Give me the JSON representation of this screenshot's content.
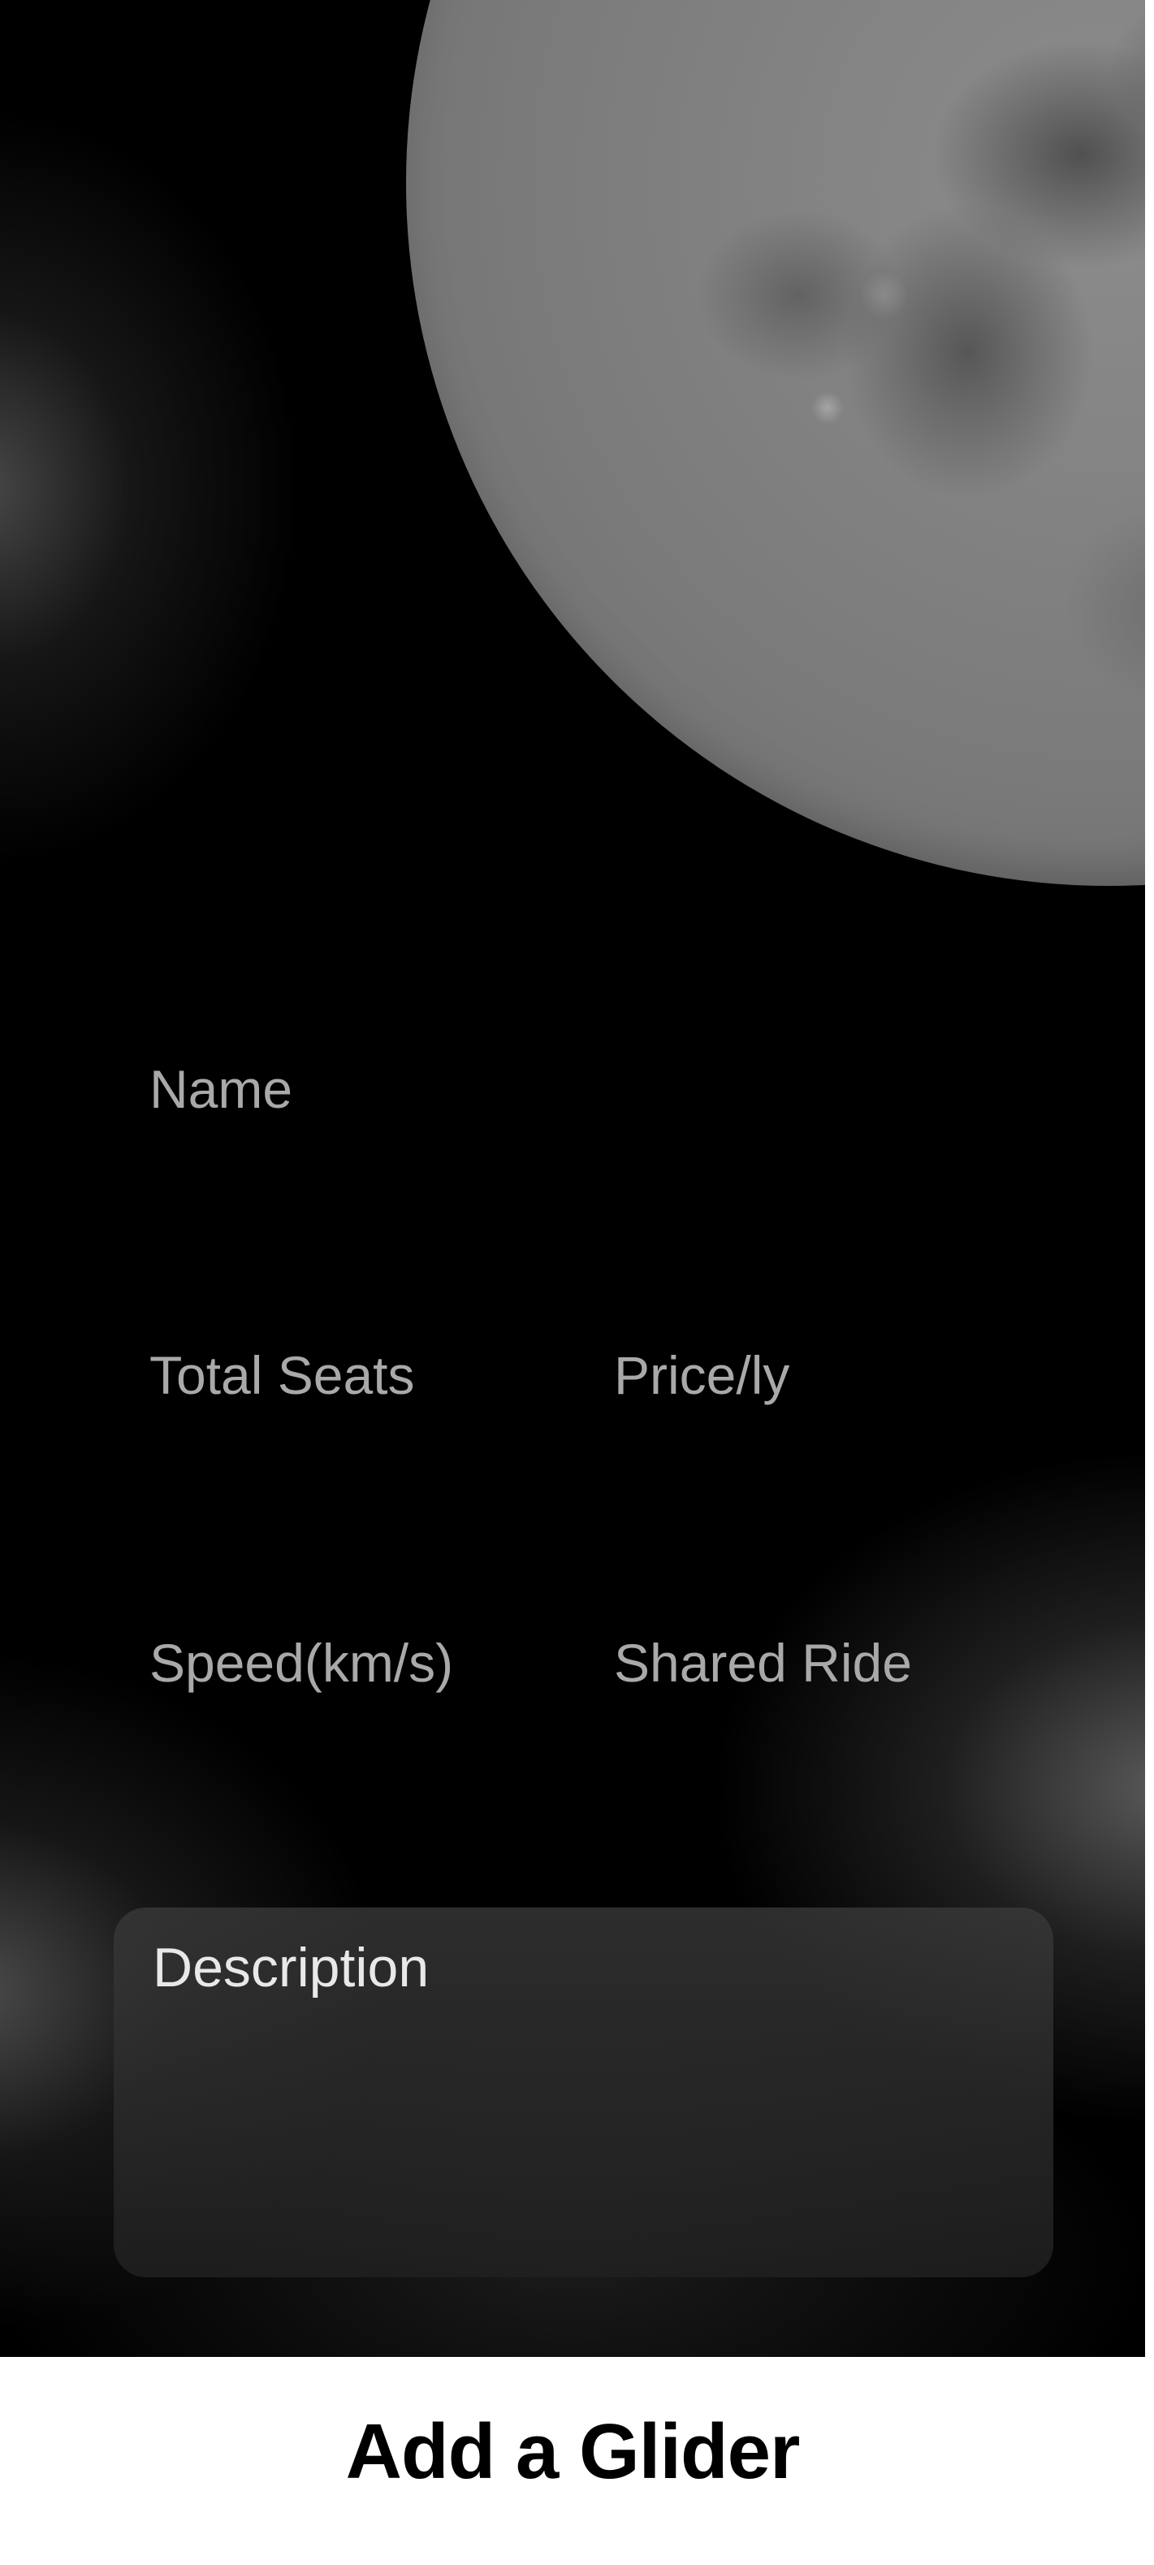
{
  "form": {
    "name_label": "Name",
    "total_seats_label": "Total Seats",
    "price_label": "Price/ly",
    "speed_label": "Speed(km/s)",
    "shared_ride_label": "Shared Ride",
    "description_label": "Description"
  },
  "footer": {
    "title": "Add a Glider"
  },
  "colors": {
    "background": "#000000",
    "label": "#a9a9a9",
    "footer_background": "#ffffff",
    "footer_text": "#000000"
  }
}
